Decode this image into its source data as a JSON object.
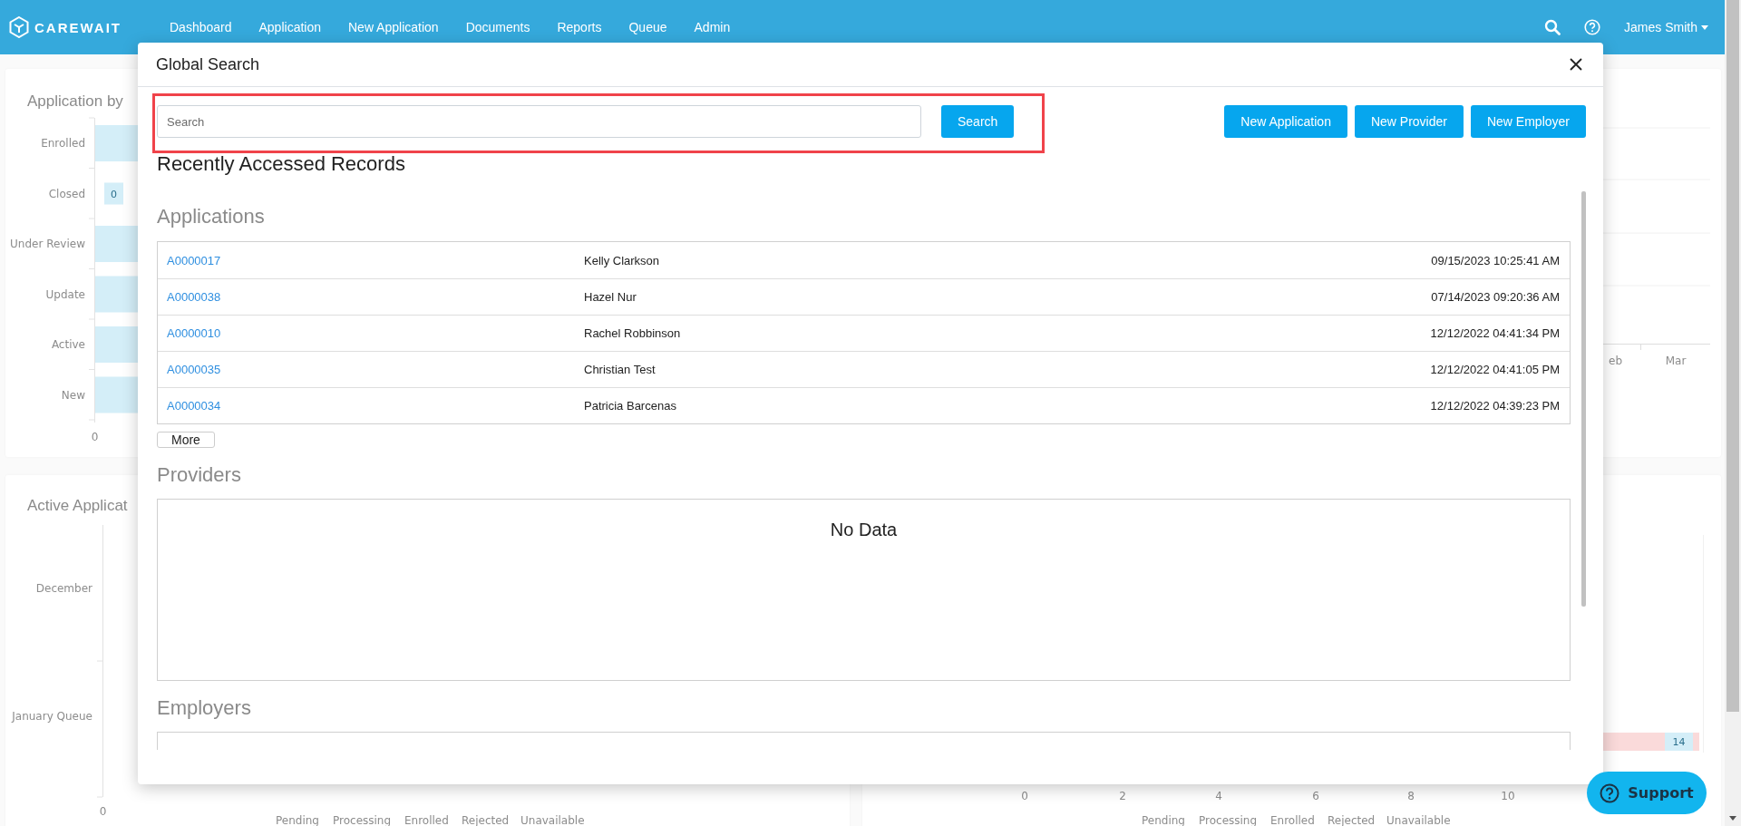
{
  "navbar": {
    "logo": "CAREWAIT",
    "items": [
      "Dashboard",
      "Application",
      "New Application",
      "Documents",
      "Reports",
      "Queue",
      "Admin"
    ],
    "user": "James Smith"
  },
  "dashboard": {
    "status_chart": {
      "title": "Application by",
      "categories": [
        {
          "label": "Enrolled",
          "kind": "bar"
        },
        {
          "label": "Closed",
          "kind": "badge",
          "badge": "0"
        },
        {
          "label": "Under Review",
          "kind": "bar"
        },
        {
          "label": "Update",
          "kind": "bar"
        },
        {
          "label": "Active",
          "kind": "bar"
        },
        {
          "label": "New",
          "kind": "bar"
        }
      ],
      "axis_label": "0"
    },
    "trend_chart": {
      "x_labels": [
        "eb",
        "Mar"
      ]
    },
    "queue_chart": {
      "title": "Active Applicat",
      "categories": [
        "December",
        "January Queue"
      ],
      "axis_label": "0",
      "legend": [
        "Pending",
        "Processing",
        "Enrolled",
        "Rejected",
        "Unavailable"
      ]
    },
    "count_chart": {
      "ticks": [
        "0",
        "2",
        "4",
        "6",
        "8",
        "10"
      ],
      "bar_badge": "14",
      "legend": [
        "Pending",
        "Processing",
        "Enrolled",
        "Rejected",
        "Unavailable"
      ]
    }
  },
  "modal": {
    "title": "Global Search",
    "search": {
      "placeholder": "Search",
      "button": "Search",
      "highlighted": true
    },
    "actions": [
      "New Application",
      "New Provider",
      "New Employer"
    ],
    "heading": "Recently Accessed Records",
    "sections": [
      {
        "title": "Applications",
        "kind": "table",
        "rows": [
          {
            "id": "A0000017",
            "name": "Kelly Clarkson",
            "time": "09/15/2023 10:25:41 AM"
          },
          {
            "id": "A0000038",
            "name": "Hazel Nur",
            "time": "07/14/2023 09:20:36 AM"
          },
          {
            "id": "A0000010",
            "name": "Rachel Robbinson",
            "time": "12/12/2022 04:41:34 PM"
          },
          {
            "id": "A0000035",
            "name": "Christian Test",
            "time": "12/12/2022 04:41:05 PM"
          },
          {
            "id": "A0000034",
            "name": "Patricia Barcenas",
            "time": "12/12/2022 04:39:23 PM"
          }
        ],
        "more": "More"
      },
      {
        "title": "Providers",
        "kind": "empty",
        "empty_text": "No Data"
      },
      {
        "title": "Employers",
        "kind": "empty"
      }
    ]
  },
  "support_button": {
    "label": "Support"
  }
}
